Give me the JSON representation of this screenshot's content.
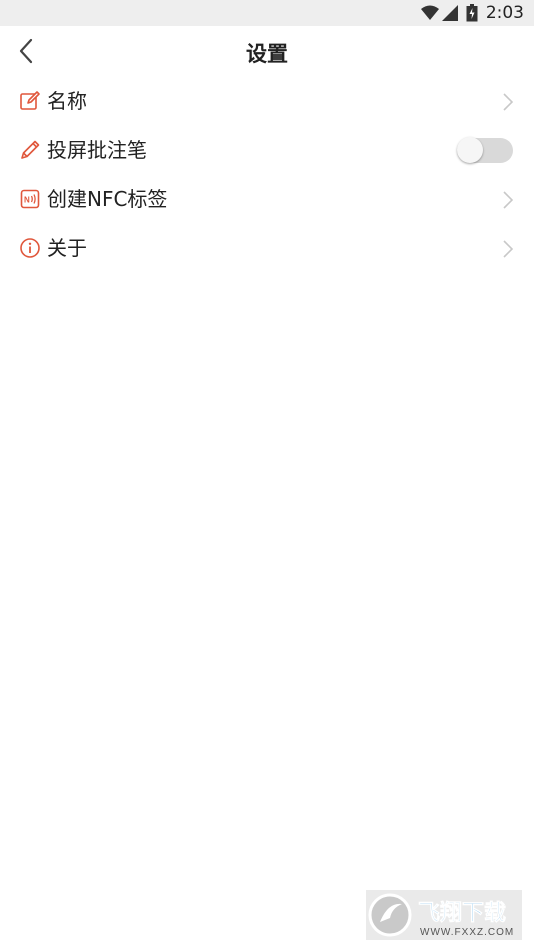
{
  "status_bar": {
    "time": "2:03",
    "icons": [
      "wifi-icon",
      "signal-icon",
      "battery-icon"
    ]
  },
  "header": {
    "title": "设置",
    "back_icon": "chevron-left-icon"
  },
  "settings": {
    "items": [
      {
        "label": "名称",
        "icon": "edit-icon",
        "control": "chevron"
      },
      {
        "label": "投屏批注笔",
        "icon": "pencil-icon",
        "control": "toggle",
        "toggle_on": false
      },
      {
        "label": "创建NFC标签",
        "icon": "nfc-icon",
        "control": "chevron"
      },
      {
        "label": "关于",
        "icon": "info-icon",
        "control": "chevron"
      }
    ]
  },
  "watermark": {
    "name": "飞翔下载",
    "url": "WWW.FXXZ.COM"
  },
  "colors": {
    "accent": "#e0573c",
    "toggle_off": "#d9d9d9",
    "text": "#222222",
    "chevron": "#c8c8c8"
  }
}
